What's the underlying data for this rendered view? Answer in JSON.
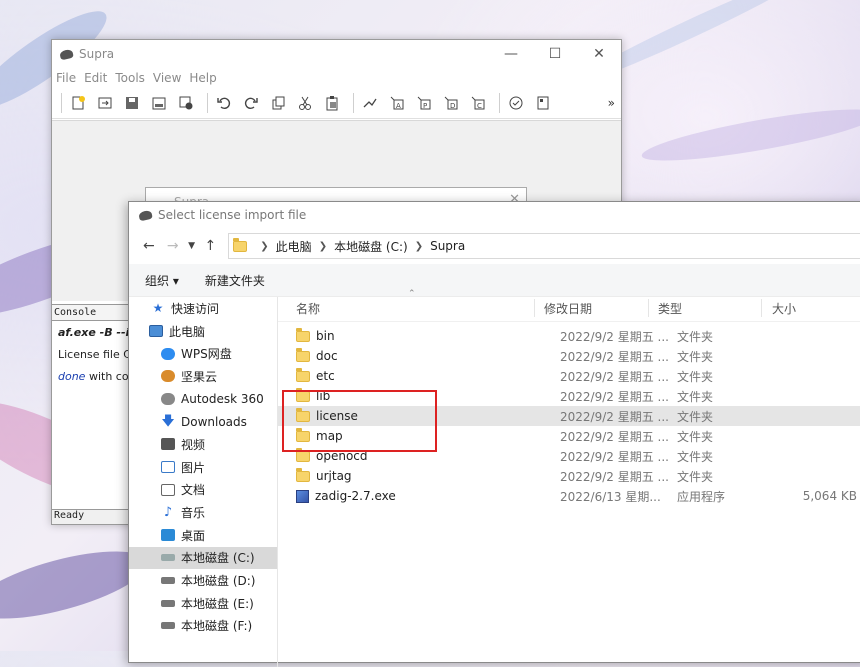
{
  "supra": {
    "title": "Supra",
    "menu": [
      "File",
      "Edit",
      "Tools",
      "View",
      "Help"
    ],
    "toolbar_icons": [
      "new-file-icon",
      "open-icon",
      "save-icon",
      "save-as-icon",
      "settings-icon",
      "undo-icon",
      "redo-icon",
      "copy-icon",
      "cut-icon",
      "paste-icon",
      "fit-icon",
      "align-a-icon",
      "align-b-icon",
      "align-c-icon",
      "align-d-icon",
      "check-icon",
      "properties-icon"
    ],
    "console_tab": "Console",
    "console_lines": {
      "cmd": "af.exe -B --imp",
      "license": "License file C",
      "done_word": "done",
      "done_rest": " with cod"
    },
    "status": "Ready",
    "inner_dialog_title": "Supra"
  },
  "dialog": {
    "title": "Select license import file",
    "address": [
      "此电脑",
      "本地磁盘 (C:)",
      "Supra"
    ],
    "commands": {
      "organize": "组织 ▾",
      "new_folder": "新建文件夹"
    },
    "columns": {
      "name": "名称",
      "date": "修改日期",
      "type": "类型",
      "size": "大小"
    },
    "nav": [
      {
        "label": "快速访问",
        "icon": "star-icon"
      },
      {
        "label": "此电脑",
        "icon": "computer-icon"
      },
      {
        "label": "WPS网盘",
        "icon": "cloud-icon"
      },
      {
        "label": "坚果云",
        "icon": "nut-icon"
      },
      {
        "label": "Autodesk 360",
        "icon": "autodesk-icon"
      },
      {
        "label": "Downloads",
        "icon": "download-icon"
      },
      {
        "label": "视频",
        "icon": "video-icon"
      },
      {
        "label": "图片",
        "icon": "image-icon"
      },
      {
        "label": "文档",
        "icon": "document-icon"
      },
      {
        "label": "音乐",
        "icon": "music-icon"
      },
      {
        "label": "桌面",
        "icon": "desktop-icon"
      },
      {
        "label": "本地磁盘 (C:)",
        "icon": "drive-icon"
      },
      {
        "label": "本地磁盘 (D:)",
        "icon": "drive-icon"
      },
      {
        "label": "本地磁盘 (E:)",
        "icon": "drive-icon"
      },
      {
        "label": "本地磁盘 (F:)",
        "icon": "drive-icon"
      }
    ],
    "files": [
      {
        "name": "bin",
        "date": "2022/9/2 星期五 ...",
        "type": "文件夹",
        "size": ""
      },
      {
        "name": "doc",
        "date": "2022/9/2 星期五 ...",
        "type": "文件夹",
        "size": ""
      },
      {
        "name": "etc",
        "date": "2022/9/2 星期五 ...",
        "type": "文件夹",
        "size": ""
      },
      {
        "name": "lib",
        "date": "2022/9/2 星期五 ...",
        "type": "文件夹",
        "size": ""
      },
      {
        "name": "license",
        "date": "2022/9/2 星期五 ...",
        "type": "文件夹",
        "size": ""
      },
      {
        "name": "map",
        "date": "2022/9/2 星期五 ...",
        "type": "文件夹",
        "size": ""
      },
      {
        "name": "openocd",
        "date": "2022/9/2 星期五 ...",
        "type": "文件夹",
        "size": ""
      },
      {
        "name": "urjtag",
        "date": "2022/9/2 星期五 ...",
        "type": "文件夹",
        "size": ""
      },
      {
        "name": "zadig-2.7.exe",
        "date": "2022/6/13 星期...",
        "type": "应用程序",
        "size": "5,064 KB"
      }
    ]
  },
  "colors": {
    "highlight": "#dd2222",
    "selected_row": "#e5e5e5",
    "link_blue": "#1a3fb0"
  }
}
